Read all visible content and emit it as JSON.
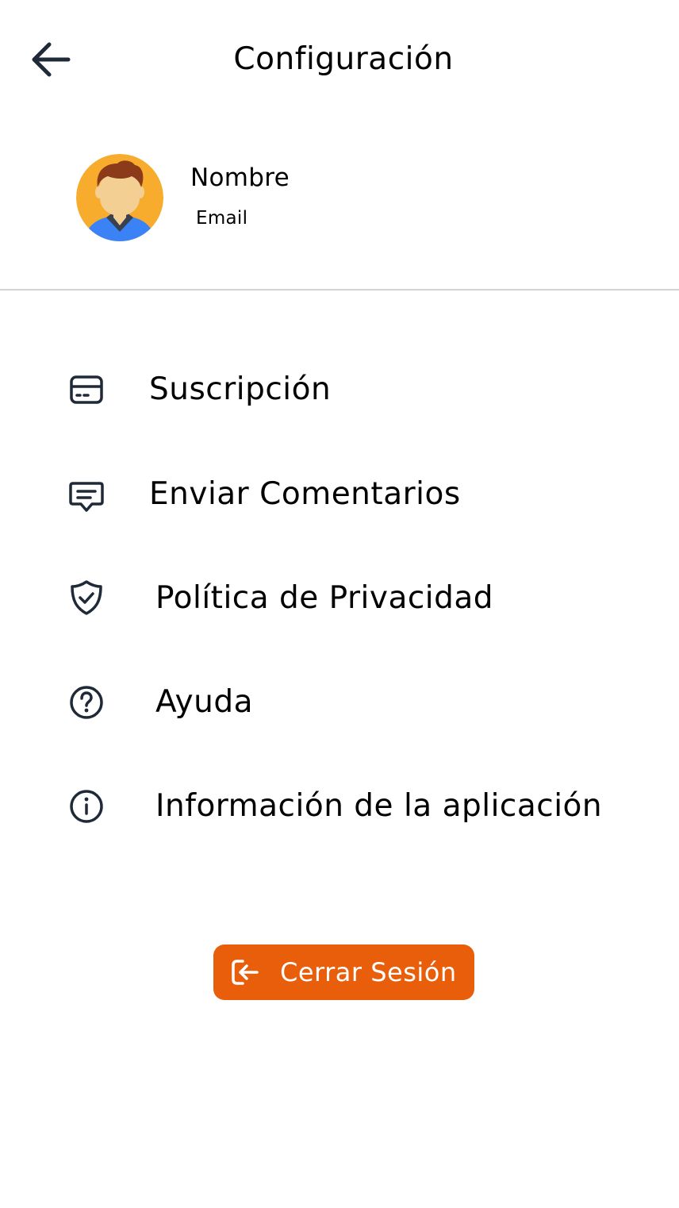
{
  "header": {
    "title": "Configuración",
    "back_icon": "arrow-left-icon"
  },
  "profile": {
    "name": "Nombre",
    "email": "Email",
    "avatar_icon": "user-avatar"
  },
  "menu": {
    "items": [
      {
        "label": "Suscripción",
        "icon": "credit-card-icon"
      },
      {
        "label": "Enviar Comentarios",
        "icon": "message-icon"
      },
      {
        "label": "Política de Privacidad",
        "icon": "shield-check-icon"
      },
      {
        "label": "Ayuda",
        "icon": "help-circle-icon"
      },
      {
        "label": "Información de la aplicación",
        "icon": "info-circle-icon"
      }
    ]
  },
  "logout": {
    "label": "Cerrar Sesión",
    "icon": "logout-icon"
  },
  "colors": {
    "text": "#000000",
    "icon": "#1f2937",
    "accent": "#e85e0a",
    "divider": "#d3d3d3",
    "avatar_bg": "#f8ac2e",
    "avatar_shirt": "#3b82f6"
  }
}
